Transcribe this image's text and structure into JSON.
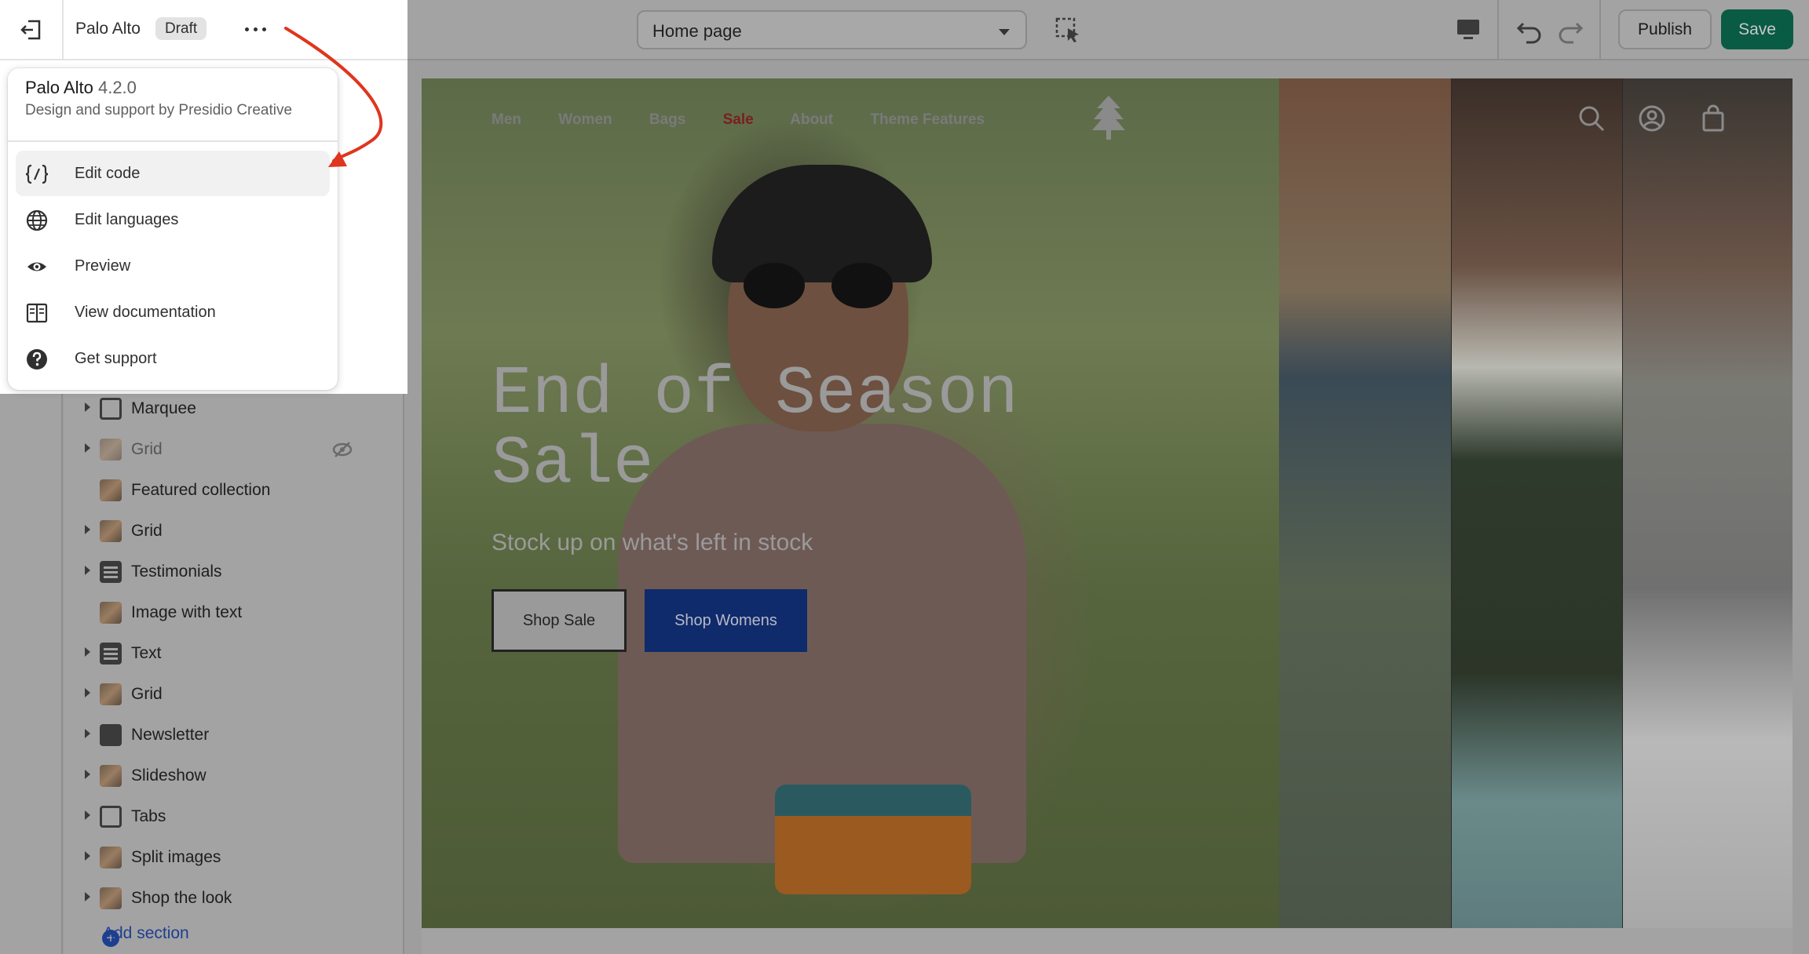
{
  "theme": {
    "name": "Palo Alto",
    "status_badge": "Draft"
  },
  "toolbar": {
    "page_select": "Home page",
    "publish_label": "Publish",
    "save_label": "Save"
  },
  "theme_menu": {
    "title": "Palo Alto",
    "version": "4.2.0",
    "subtitle": "Design and support by Presidio Creative",
    "items": [
      {
        "label": "Edit code",
        "icon": "code-icon"
      },
      {
        "label": "Edit languages",
        "icon": "globe-icon"
      },
      {
        "label": "Preview",
        "icon": "eye-icon"
      },
      {
        "label": "View documentation",
        "icon": "book-icon"
      },
      {
        "label": "Get support",
        "icon": "question-icon"
      }
    ]
  },
  "sidebar": {
    "sections": [
      {
        "label": "Marquee",
        "thumb": "marquee-icon",
        "expandable": true
      },
      {
        "label": "Grid",
        "thumb": "image-thumbnail",
        "expandable": true,
        "hidden": true
      },
      {
        "label": "Featured collection",
        "thumb": "image-thumbnail",
        "expandable": false
      },
      {
        "label": "Grid",
        "thumb": "image-thumbnail",
        "expandable": true
      },
      {
        "label": "Testimonials",
        "thumb": "text-block-icon",
        "expandable": true
      },
      {
        "label": "Image with text",
        "thumb": "image-thumbnail",
        "expandable": false
      },
      {
        "label": "Text",
        "thumb": "text-block-icon",
        "expandable": true
      },
      {
        "label": "Grid",
        "thumb": "image-thumbnail",
        "expandable": true
      },
      {
        "label": "Newsletter",
        "thumb": "envelope-icon",
        "expandable": true
      },
      {
        "label": "Slideshow",
        "thumb": "image-thumbnail",
        "expandable": true
      },
      {
        "label": "Tabs",
        "thumb": "tabs-icon",
        "expandable": true
      },
      {
        "label": "Split images",
        "thumb": "image-thumbnail",
        "expandable": true
      },
      {
        "label": "Shop the look",
        "thumb": "image-thumbnail",
        "expandable": true
      }
    ],
    "add_section_label": "Add section"
  },
  "preview": {
    "nav": [
      "Men",
      "Women",
      "Bags",
      "Sale",
      "About",
      "Theme Features"
    ],
    "headline": "End of Season Sale",
    "subheadline": "Stock up on what's left in stock",
    "button_primary": "Shop Sale",
    "button_secondary": "Shop Womens"
  },
  "colors": {
    "save_button": "#0a5b44",
    "annotation_arrow": "#e0351e",
    "secondary_button": "#0f2b6b",
    "sale_link": "#7a1f1f"
  }
}
